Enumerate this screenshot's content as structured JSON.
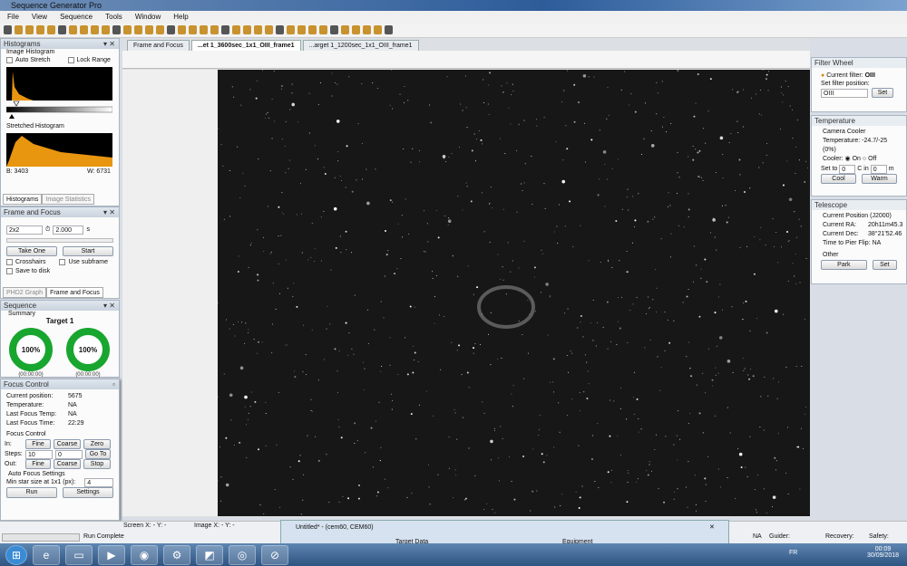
{
  "app": {
    "title": "Sequence Generator Pro"
  },
  "menu": [
    "File",
    "View",
    "Sequence",
    "Tools",
    "Window",
    "Help"
  ],
  "histograms": {
    "title": "Histograms",
    "image_histogram": "Image Histogram",
    "auto_stretch": "Auto Stretch",
    "lock_range": "Lock Range",
    "stretched_histogram": "Stretched Histogram",
    "black": "B: 3403",
    "white": "W:  6731",
    "tab1": "Histograms",
    "tab2": "Image Statistics",
    "hist_color": "#e8950f"
  },
  "frame_focus": {
    "title": "Frame and Focus",
    "binning": "2x2",
    "exposure": "2.000",
    "unit": "s",
    "take_one": "Take One",
    "start": "Start",
    "crosshairs": "Crosshairs",
    "use_subframe": "Use subframe",
    "save_to_disk": "Save to disk",
    "tab1": "PHD2 Graph",
    "tab2": "Frame and Focus"
  },
  "sequence": {
    "title": "Sequence",
    "summary": "Summary",
    "target": "Target 1",
    "ring1": "100%",
    "ring2": "100%",
    "time1": "(00:00:00)",
    "time2": "(00:00:00)",
    "ring_color": "#18a62f"
  },
  "focus": {
    "title": "Focus Control",
    "current_position_label": "Current position:",
    "current_position": "5675",
    "temperature_label": "Temperature:",
    "temperature": "NA",
    "last_focus_temp_label": "Last Focus Temp:",
    "last_focus_temp": "NA",
    "last_focus_time_label": "Last Focus Time:",
    "last_focus_time": "22:29",
    "focus_control": "Focus Control",
    "in": "In:",
    "steps": "Steps:",
    "out": "Out:",
    "fine": "Fine",
    "coarse": "Coarse",
    "zero": "Zero",
    "goto": "Go To",
    "stop": "Stop",
    "steps_val1": "10",
    "steps_val2": "0",
    "auto_focus": "Auto Focus Settings",
    "min_star": "Min star size at 1x1 (px):",
    "min_star_val": "4",
    "run": "Run",
    "settings": "Settings"
  },
  "doc_tabs": [
    "Frame and Focus",
    "...et 1_3600sec_1x1_OIII_frame1",
    "...arget 1_1200sec_1x1_OIII_frame1"
  ],
  "filter_wheel": {
    "title": "Filter Wheel",
    "current_filter_label": "Current filter:",
    "current_filter": "OIII",
    "set_position": "Set filter position:",
    "selected": "OIII",
    "set": "Set"
  },
  "temperature": {
    "title": "Temperature",
    "camera_cooler": "Camera Cooler",
    "temperature": "Temperature: -24.7/-25 (0%)",
    "cooler": "Cooler:",
    "on": "On",
    "off": "Off",
    "set_to": "Set to",
    "set_val": "0",
    "c_in": "C in",
    "min_val": "0",
    "m": "m",
    "cool": "Cool",
    "warm": "Warm"
  },
  "telescope": {
    "title": "Telescope",
    "position": "Current Position (J2000)",
    "ra_label": "Current RA:",
    "ra": "20h11m45.3",
    "dec_label": "Current Dec:",
    "dec": "38°21'52.46",
    "pier_label": "Time to Pier Flip:",
    "pier": "NA",
    "other": "Other",
    "park": "Park",
    "set": "Set"
  },
  "status": {
    "screen": "Screen X: - Y: -",
    "image": "Image X: - Y: -",
    "run_complete": "Run Complete",
    "na": "NA",
    "guider": "Guider:",
    "recovery": "Recovery:",
    "safety": "Safety:"
  },
  "untitled": {
    "title": "Untitled* - (cem60, CEM60)",
    "target_data": "Target Data",
    "equipment": "Equipment"
  },
  "taskbar": {
    "lang": "FR",
    "time": "00:09",
    "date": "30/09/2018"
  }
}
